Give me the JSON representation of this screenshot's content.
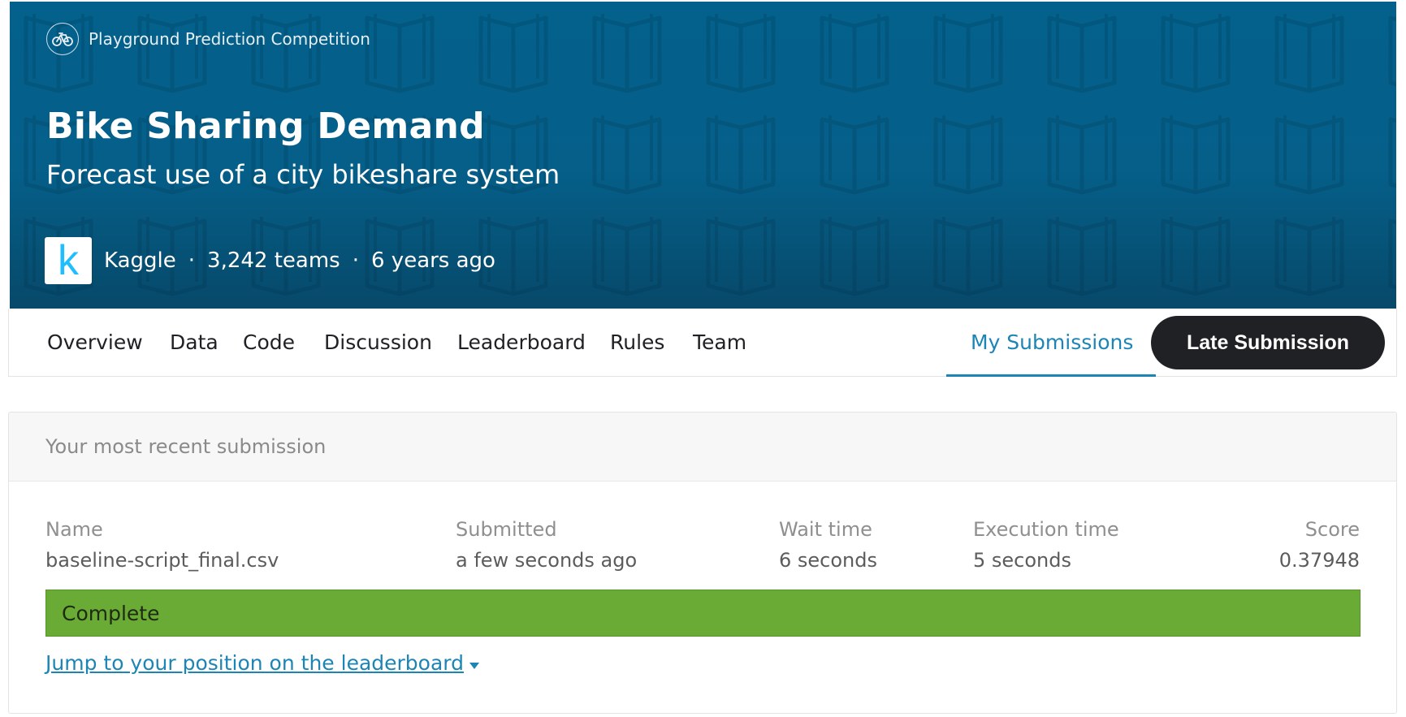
{
  "header": {
    "competition_type": "Playground Prediction Competition",
    "title": "Bike Sharing Demand",
    "subtitle": "Forecast use of a city bikeshare system",
    "host": "Kaggle",
    "host_logo_letter": "k",
    "teams": "3,242 teams",
    "age": "6 years ago",
    "separator": "·",
    "banner_color": "#03618c"
  },
  "tabs": {
    "overview": "Overview",
    "data": "Data",
    "code": "Code",
    "discussion": "Discussion",
    "leaderboard": "Leaderboard",
    "rules": "Rules",
    "team": "Team",
    "my_submissions": "My Submissions",
    "active": "My Submissions",
    "late_submission": "Late Submission"
  },
  "submission": {
    "card_title": "Your most recent submission",
    "columns": {
      "name_label": "Name",
      "name_value": "baseline-script_final.csv",
      "submitted_label": "Submitted",
      "submitted_value": "a few seconds ago",
      "wait_label": "Wait time",
      "wait_value": "6 seconds",
      "exec_label": "Execution time",
      "exec_value": "5 seconds",
      "score_label": "Score",
      "score_value": "0.37948"
    },
    "status": "Complete",
    "status_color": "#69ab34",
    "jump_link": "Jump to your position on the leaderboard",
    "link_color": "#1c85b5"
  },
  "icons": {
    "competition_type": "bicycle-icon",
    "jump_caret": "caret-down-icon"
  }
}
